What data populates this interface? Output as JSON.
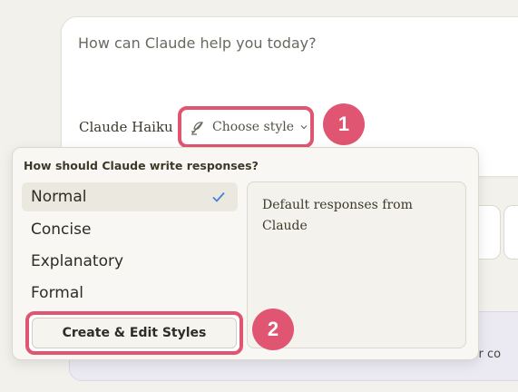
{
  "chat": {
    "prompt_placeholder": "How can Claude help you today?",
    "model_name": "Claude Haiku",
    "style_button_label": "Choose style"
  },
  "annotations": {
    "step1": "1",
    "step2": "2",
    "accent_color": "#e05571"
  },
  "style_menu": {
    "title": "How should Claude write responses?",
    "options": [
      {
        "label": "Normal",
        "selected": true
      },
      {
        "label": "Concise",
        "selected": false
      },
      {
        "label": "Explanatory",
        "selected": false
      },
      {
        "label": "Formal",
        "selected": false
      }
    ],
    "description": "Default responses from Claude",
    "create_button_label": "Create & Edit Styles"
  },
  "background": {
    "partial_text": "for co"
  },
  "icons": {
    "style_icon": "feather-pen-icon",
    "dropdown_icon": "chevron-down-icon",
    "selected_icon": "checkmark-icon"
  }
}
